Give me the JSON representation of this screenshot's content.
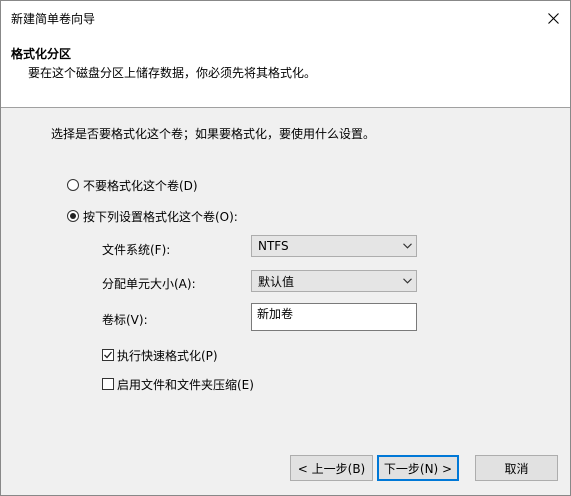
{
  "window": {
    "title": "新建简单卷向导"
  },
  "header": {
    "title": "格式化分区",
    "description": "要在这个磁盘分区上储存数据，你必须先将其格式化。"
  },
  "body": {
    "prompt": "选择是否要格式化这个卷；如果要格式化，要使用什么设置。",
    "radio_no_format": {
      "label": "不要格式化这个卷(D)",
      "checked": false
    },
    "radio_format": {
      "label": "按下列设置格式化这个卷(O):",
      "checked": true
    },
    "fields": {
      "file_system": {
        "label": "文件系统(F):",
        "value": "NTFS"
      },
      "allocation_unit": {
        "label": "分配单元大小(A):",
        "value": "默认值"
      },
      "volume_label": {
        "label": "卷标(V):",
        "value": "新加卷"
      }
    },
    "quick_format": {
      "label": "执行快速格式化(P)",
      "checked": true
    },
    "compression": {
      "label": "启用文件和文件夹压缩(E)",
      "checked": false
    }
  },
  "footer": {
    "back_label": "< 上一步(B)",
    "next_label": "下一步(N) >",
    "cancel_label": "取消"
  },
  "colors": {
    "accent": "#0078d7",
    "panel_bg": "#f0f0f0"
  }
}
